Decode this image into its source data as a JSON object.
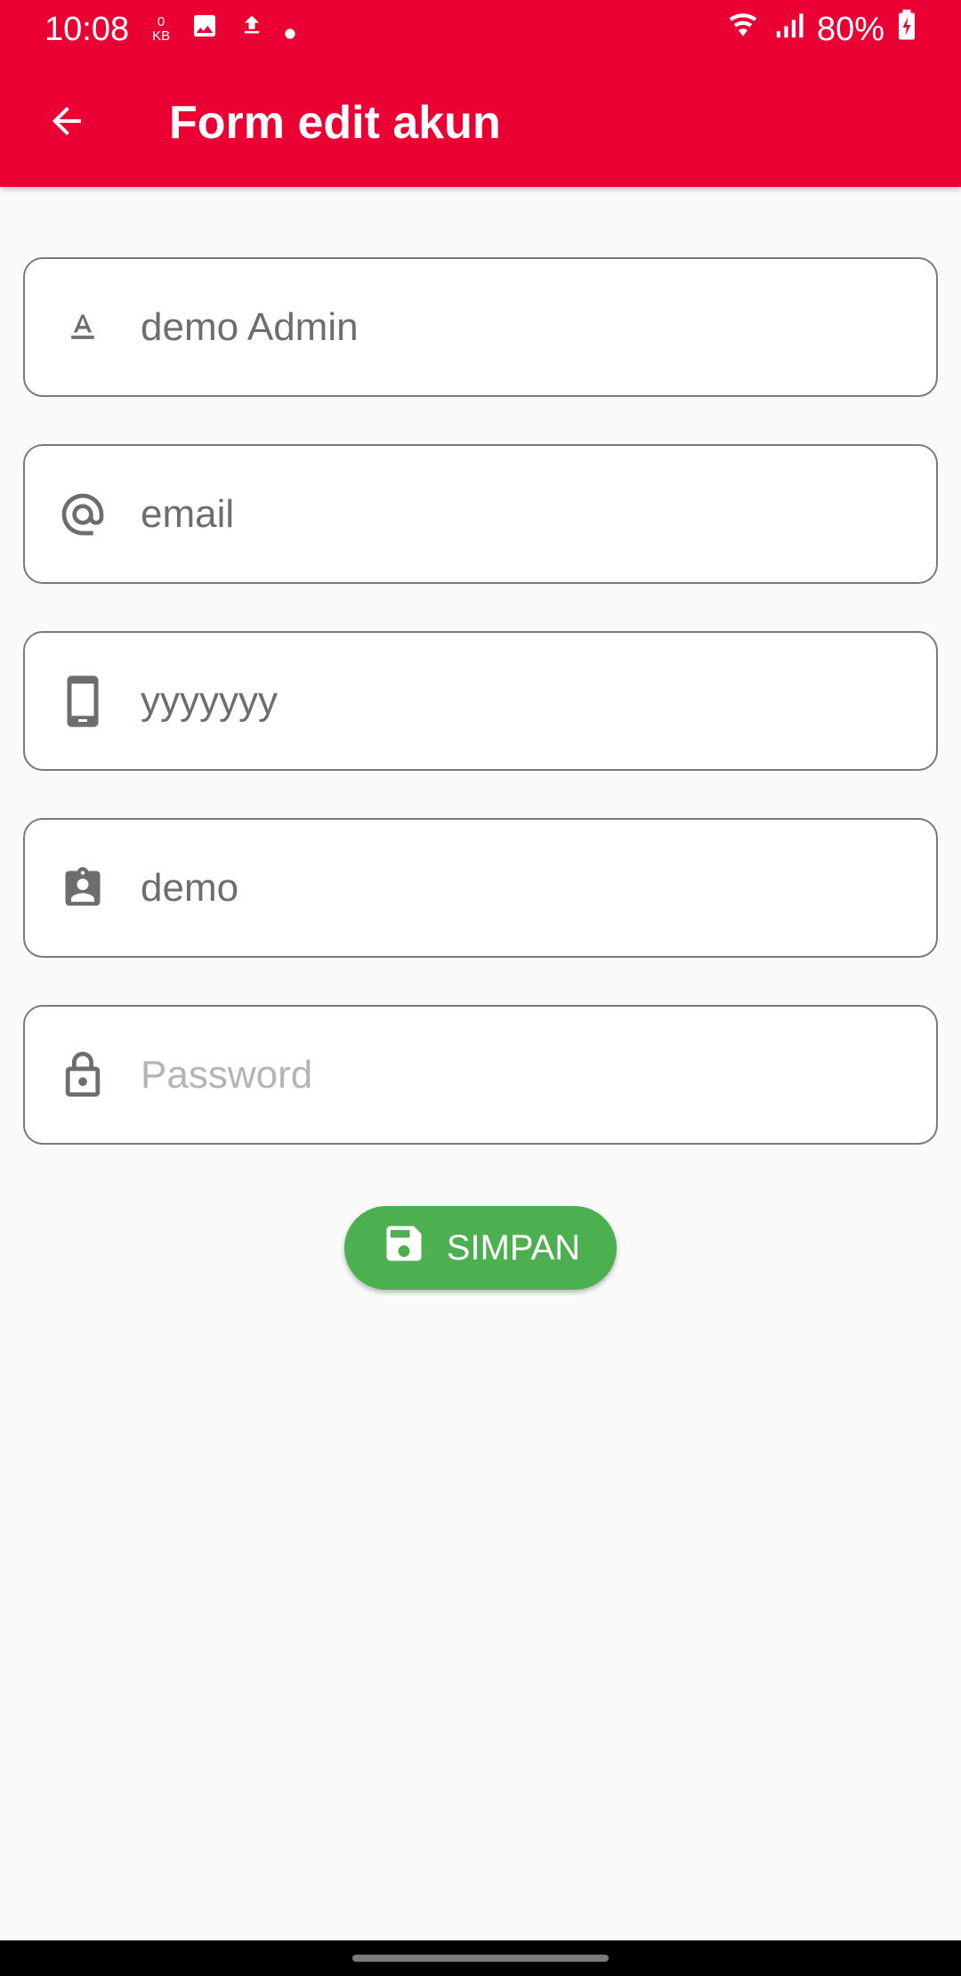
{
  "status_bar": {
    "time": "10:08",
    "kb_value": "0",
    "kb_unit": "KB",
    "battery": "80%",
    "icons": [
      "gallery-icon",
      "upload-icon",
      "dot-icon",
      "wifi-icon",
      "signal-icon",
      "battery-charging-icon"
    ]
  },
  "app_bar": {
    "title": "Form edit akun",
    "back_icon": "arrow-back-icon",
    "background": "#ea0033"
  },
  "form": {
    "name": {
      "icon": "text-format-icon",
      "value": "demo Admin"
    },
    "email": {
      "icon": "at-icon",
      "value": "email"
    },
    "phone": {
      "icon": "phone-icon",
      "value": "yyyyyyy"
    },
    "username": {
      "icon": "badge-icon",
      "value": "demo"
    },
    "password": {
      "icon": "lock-icon",
      "value": "",
      "placeholder": "Password"
    }
  },
  "save_button": {
    "label": "SIMPAN",
    "icon": "save-icon",
    "color": "#4caf50"
  }
}
